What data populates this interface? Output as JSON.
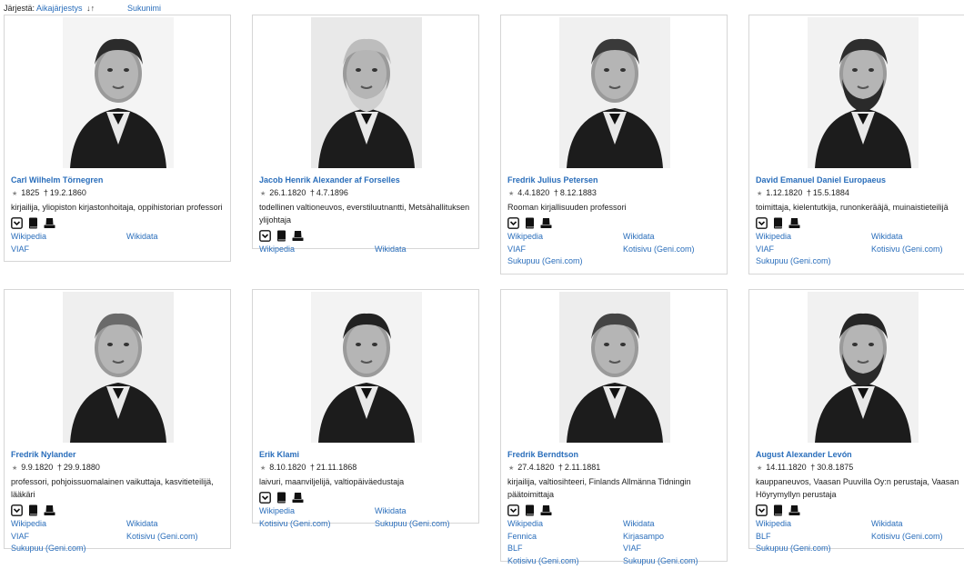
{
  "sort": {
    "label": "Järjestä:",
    "option_time": "Aikajärjestys",
    "sort_icon": "sort-ascending-icon",
    "option_name": "Sukunimi"
  },
  "people": [
    {
      "name": "Carl Wilhelm Törnegren",
      "born": "1825",
      "died": "19.2.1860",
      "desc": "kirjailija, yliopiston kirjastonhoitaja, oppihistorian professori",
      "links": [
        "Wikipedia",
        "Wikidata",
        "VIAF"
      ]
    },
    {
      "name": "Jacob Henrik Alexander af Forselles",
      "born": "26.1.1820",
      "died": "4.7.1896",
      "desc": "todellinen valtioneuvos, everstiluutnantti, Metsähallituksen ylijohtaja",
      "links": [
        "Wikipedia",
        "Wikidata"
      ]
    },
    {
      "name": "Fredrik Julius Petersen",
      "born": "4.4.1820",
      "died": "8.12.1883",
      "desc": "Rooman kirjallisuuden professori",
      "links": [
        "Wikipedia",
        "Wikidata",
        "VIAF",
        "Kotisivu (Geni.com)",
        "Sukupuu (Geni.com)"
      ]
    },
    {
      "name": "David Emanuel Daniel Europaeus",
      "born": "1.12.1820",
      "died": "15.5.1884",
      "desc": "toimittaja, kielentutkija, runonkerääjä, muinaistieteilijä",
      "links": [
        "Wikipedia",
        "Wikidata",
        "VIAF",
        "Kotisivu (Geni.com)",
        "Sukupuu (Geni.com)"
      ]
    },
    {
      "name": "Fredrik Nylander",
      "born": "9.9.1820",
      "died": "29.9.1880",
      "desc": "professori, pohjoissuomalainen vaikuttaja, kasvitieteilijä, lääkäri",
      "links": [
        "Wikipedia",
        "Wikidata",
        "VIAF",
        "Kotisivu (Geni.com)",
        "Sukupuu (Geni.com)"
      ]
    },
    {
      "name": "Erik Klami",
      "born": "8.10.1820",
      "died": "21.11.1868",
      "desc": "laivuri, maanviljelijä, valtiopäiväedustaja",
      "links": [
        "Wikipedia",
        "Wikidata",
        "Kotisivu (Geni.com)",
        "Sukupuu (Geni.com)"
      ]
    },
    {
      "name": "Fredrik Berndtson",
      "born": "27.4.1820",
      "died": "2.11.1881",
      "desc": "kirjailija, valtiosihteeri, Finlands Allmänna Tidningin päätoimittaja",
      "links": [
        "Wikipedia",
        "Wikidata",
        "Fennica",
        "Kirjasampo",
        "BLF",
        "VIAF",
        "Kotisivu (Geni.com)",
        "Sukupuu (Geni.com)"
      ]
    },
    {
      "name": "August Alexander Levón",
      "born": "14.11.1820",
      "died": "30.8.1875",
      "desc": "kauppaneuvos, Vaasan Puuvilla Oy:n perustaja, Vaasan Höyrymyllyn perustaja",
      "links": [
        "Wikipedia",
        "Wikidata",
        "BLF",
        "Kotisivu (Geni.com)",
        "Sukupuu (Geni.com)"
      ]
    }
  ],
  "card_icons": [
    "inbox-icon",
    "book-icon",
    "hat-icon"
  ],
  "photo_icon": "portrait-photo"
}
